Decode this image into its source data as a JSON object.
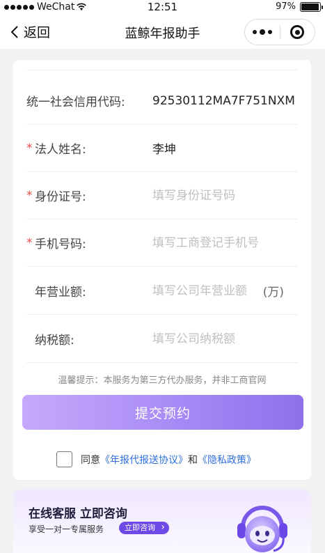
{
  "status_bar": {
    "carrier": "WeChat",
    "time": "12:51",
    "battery": "97%",
    "battery_level": 0.97
  },
  "nav": {
    "back_label": "返回",
    "title": "蓝鲸年报助手"
  },
  "form": {
    "fields": [
      {
        "label": "统一社会信用代码:",
        "value": "92530112MA7F751NXM",
        "required": false
      },
      {
        "label": "法人姓名:",
        "value": "李坤",
        "required": true
      },
      {
        "label": "身份证号:",
        "placeholder": "填写身份证号码",
        "required": true
      },
      {
        "label": "手机号码:",
        "placeholder": "填写工商登记手机号",
        "required": true
      },
      {
        "label": "年营业额:",
        "placeholder": "填写公司年营业额",
        "unit": "(万)",
        "required": false
      },
      {
        "label": "纳税额:",
        "placeholder": "填写公司纳税额",
        "required": false
      }
    ],
    "required_mark": "*",
    "tip": "温馨提示：本服务为第三方代办服务，并非工商官网",
    "submit_label": "提交预约",
    "agree_prefix": "同意",
    "agreement_link": "《年报代报送协议》",
    "and_text": "和",
    "privacy_link": "《隐私政策》"
  },
  "banner": {
    "title": "在线客服 立即咨询",
    "subtitle": "享受一对一专属服务",
    "button": "立即咨询"
  },
  "colors": {
    "required": "#e54d42",
    "link": "#2f6fdc",
    "accent": "#8e70ec",
    "placeholder": "#bfbfbf"
  }
}
